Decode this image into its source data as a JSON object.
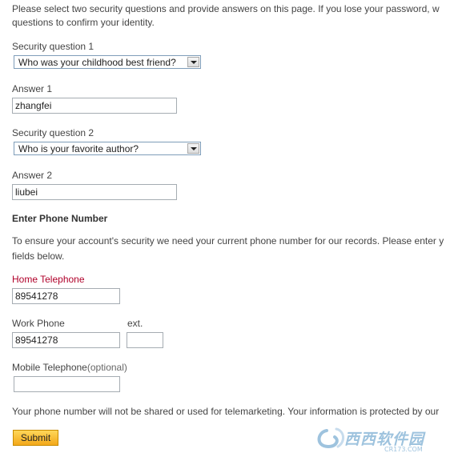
{
  "intro": {
    "line1": "Please select two security questions and provide answers on this page. If you lose your password, w",
    "line2": "questions to confirm your identity."
  },
  "security": {
    "q1_label": "Security question 1",
    "q1_value": "Who was your childhood best friend?",
    "a1_label": "Answer 1",
    "a1_value": "zhangfei",
    "q2_label": "Security question 2",
    "q2_value": "Who is your favorite author?",
    "a2_label": "Answer 2",
    "a2_value": "liubei"
  },
  "phone": {
    "heading": "Enter Phone Number",
    "desc_line1": "To ensure your account's security we need your current phone number for our records. Please enter y",
    "desc_line2": "fields below.",
    "home_label": "Home Telephone",
    "home_value": "89541278",
    "work_label": "Work Phone",
    "work_value": "89541278",
    "ext_label": "ext.",
    "ext_value": "",
    "mobile_label": "Mobile Telephone",
    "mobile_optional": "(optional)",
    "mobile_value": "",
    "note": "Your phone number will not be shared or used for telemarketing. Your information is protected by our"
  },
  "submit_label": "Submit",
  "colors": {
    "required_label": "#b0002a",
    "submit_top": "#ffd75a",
    "submit_bottom": "#f3a81a",
    "watermark": "#9ec3de"
  },
  "watermark": {
    "logo_icon": "swirl-logo-icon",
    "text": "西西软件园",
    "sub": "CR173.COM"
  }
}
